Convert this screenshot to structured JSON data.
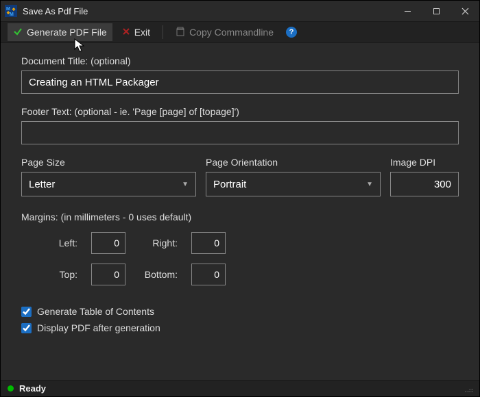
{
  "window": {
    "title": "Save As Pdf File"
  },
  "toolbar": {
    "generate": "Generate PDF File",
    "exit": "Exit",
    "copycmd": "Copy Commandline",
    "help": "?"
  },
  "form": {
    "docTitleLabel": "Document Title: (optional)",
    "docTitleValue": "Creating an HTML Packager",
    "footerLabel": "Footer Text: (optional - ie. 'Page [page] of [topage]')",
    "footerValue": "",
    "pageSizeLabel": "Page Size",
    "pageSizeValue": "Letter",
    "orientationLabel": "Page Orientation",
    "orientationValue": "Portrait",
    "dpiLabel": "Image DPI",
    "dpiValue": "300",
    "marginsLabel": "Margins: (in millimeters - 0 uses default)",
    "margins": {
      "leftLabel": "Left:",
      "leftValue": "0",
      "rightLabel": "Right:",
      "rightValue": "0",
      "topLabel": "Top:",
      "topValue": "0",
      "bottomLabel": "Bottom:",
      "bottomValue": "0"
    },
    "tocLabel": "Generate Table of Contents",
    "displayLabel": "Display PDF after generation",
    "tocChecked": true,
    "displayChecked": true
  },
  "status": {
    "text": "Ready"
  }
}
